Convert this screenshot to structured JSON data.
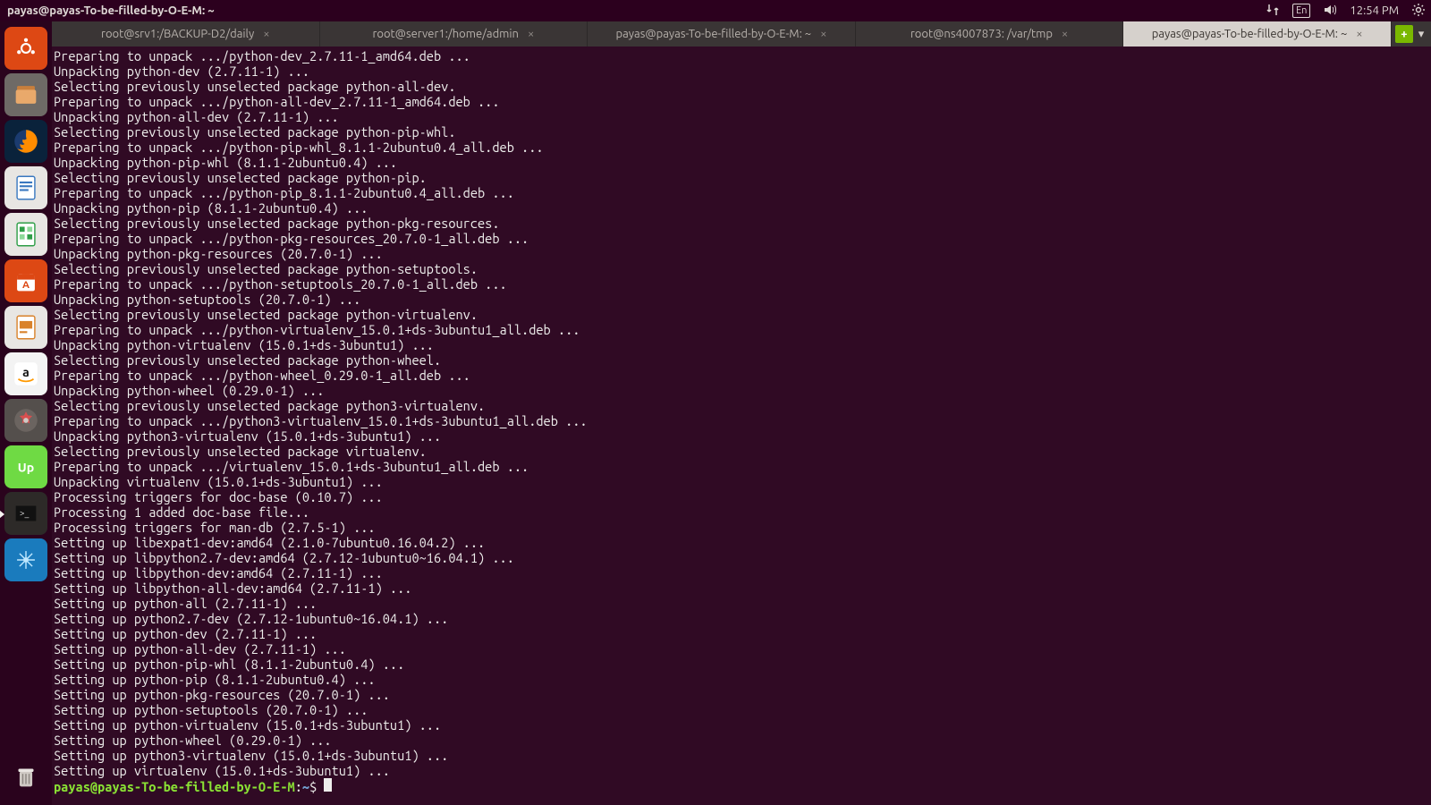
{
  "menubar": {
    "title": "payas@payas-To-be-filled-by-O-E-M: ~",
    "language": "En",
    "time": "12:54 PM"
  },
  "launcher": {
    "items": [
      {
        "name": "dash",
        "bg": "#dd4814"
      },
      {
        "name": "files",
        "bg": "#6e6a66"
      },
      {
        "name": "firefox",
        "bg": "#0a223b"
      },
      {
        "name": "writer",
        "bg": "#e8e6e3"
      },
      {
        "name": "calc",
        "bg": "#e8e6e3"
      },
      {
        "name": "software",
        "bg": "#dd4814"
      },
      {
        "name": "impress",
        "bg": "#e8e6e3"
      },
      {
        "name": "amazon",
        "bg": "#f3f3f3"
      },
      {
        "name": "settings",
        "bg": "#544f4c"
      },
      {
        "name": "upwork",
        "bg": "#6fda44"
      },
      {
        "name": "terminal",
        "bg": "#2d2a28",
        "active": true
      },
      {
        "name": "app-blue",
        "bg": "#1a7bbd"
      }
    ],
    "trash": "trash"
  },
  "tabs": [
    {
      "label": "root@srv1:/BACKUP-D2/daily"
    },
    {
      "label": "root@server1:/home/admin"
    },
    {
      "label": "payas@payas-To-be-filled-by-O-E-M: ~"
    },
    {
      "label": "root@ns4007873: /var/tmp"
    },
    {
      "label": "payas@payas-To-be-filled-by-O-E-M: ~",
      "active": true
    }
  ],
  "tab_actions": {
    "new": "+",
    "menu": "▾"
  },
  "terminal": {
    "lines": [
      "Preparing to unpack .../python-dev_2.7.11-1_amd64.deb ...",
      "Unpacking python-dev (2.7.11-1) ...",
      "Selecting previously unselected package python-all-dev.",
      "Preparing to unpack .../python-all-dev_2.7.11-1_amd64.deb ...",
      "Unpacking python-all-dev (2.7.11-1) ...",
      "Selecting previously unselected package python-pip-whl.",
      "Preparing to unpack .../python-pip-whl_8.1.1-2ubuntu0.4_all.deb ...",
      "Unpacking python-pip-whl (8.1.1-2ubuntu0.4) ...",
      "Selecting previously unselected package python-pip.",
      "Preparing to unpack .../python-pip_8.1.1-2ubuntu0.4_all.deb ...",
      "Unpacking python-pip (8.1.1-2ubuntu0.4) ...",
      "Selecting previously unselected package python-pkg-resources.",
      "Preparing to unpack .../python-pkg-resources_20.7.0-1_all.deb ...",
      "Unpacking python-pkg-resources (20.7.0-1) ...",
      "Selecting previously unselected package python-setuptools.",
      "Preparing to unpack .../python-setuptools_20.7.0-1_all.deb ...",
      "Unpacking python-setuptools (20.7.0-1) ...",
      "Selecting previously unselected package python-virtualenv.",
      "Preparing to unpack .../python-virtualenv_15.0.1+ds-3ubuntu1_all.deb ...",
      "Unpacking python-virtualenv (15.0.1+ds-3ubuntu1) ...",
      "Selecting previously unselected package python-wheel.",
      "Preparing to unpack .../python-wheel_0.29.0-1_all.deb ...",
      "Unpacking python-wheel (0.29.0-1) ...",
      "Selecting previously unselected package python3-virtualenv.",
      "Preparing to unpack .../python3-virtualenv_15.0.1+ds-3ubuntu1_all.deb ...",
      "Unpacking python3-virtualenv (15.0.1+ds-3ubuntu1) ...",
      "Selecting previously unselected package virtualenv.",
      "Preparing to unpack .../virtualenv_15.0.1+ds-3ubuntu1_all.deb ...",
      "Unpacking virtualenv (15.0.1+ds-3ubuntu1) ...",
      "Processing triggers for doc-base (0.10.7) ...",
      "Processing 1 added doc-base file...",
      "Processing triggers for man-db (2.7.5-1) ...",
      "Setting up libexpat1-dev:amd64 (2.1.0-7ubuntu0.16.04.2) ...",
      "Setting up libpython2.7-dev:amd64 (2.7.12-1ubuntu0~16.04.1) ...",
      "Setting up libpython-dev:amd64 (2.7.11-1) ...",
      "Setting up libpython-all-dev:amd64 (2.7.11-1) ...",
      "Setting up python-all (2.7.11-1) ...",
      "Setting up python2.7-dev (2.7.12-1ubuntu0~16.04.1) ...",
      "Setting up python-dev (2.7.11-1) ...",
      "Setting up python-all-dev (2.7.11-1) ...",
      "Setting up python-pip-whl (8.1.1-2ubuntu0.4) ...",
      "Setting up python-pip (8.1.1-2ubuntu0.4) ...",
      "Setting up python-pkg-resources (20.7.0-1) ...",
      "Setting up python-setuptools (20.7.0-1) ...",
      "Setting up python-virtualenv (15.0.1+ds-3ubuntu1) ...",
      "Setting up python-wheel (0.29.0-1) ...",
      "Setting up python3-virtualenv (15.0.1+ds-3ubuntu1) ...",
      "Setting up virtualenv (15.0.1+ds-3ubuntu1) ..."
    ],
    "prompt": {
      "user": "payas@payas-To-be-filled-by-O-E-M",
      "sep": ":",
      "path": "~",
      "end": "$ "
    }
  }
}
